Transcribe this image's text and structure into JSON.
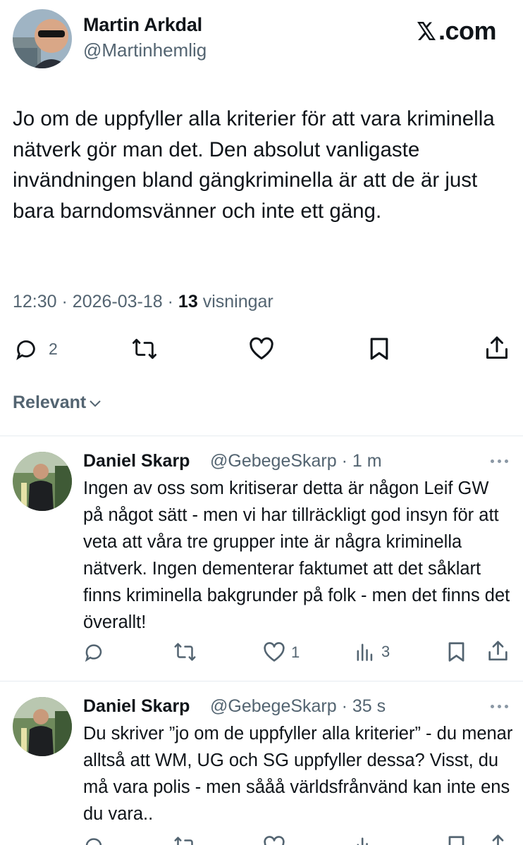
{
  "brand": {
    "name": "X",
    "domain_label": ".com"
  },
  "tweet": {
    "author_name": "Martin Arkdal",
    "author_handle": "@Martinhemlig",
    "text": "Jo om de uppfyller alla kriterier för att vara kriminella nätverk gör man det. Den absolut vanligaste invändningen bland gängkriminella är att de är just bara barndomsvänner och inte ett gäng.",
    "time": "12:30",
    "date": "2026-03-18",
    "separator": "·",
    "views": "13",
    "views_label": "visningar",
    "reply_count": "2",
    "icons": [
      "reply-icon",
      "retweet-icon",
      "like-icon",
      "bookmark-icon",
      "share-icon"
    ]
  },
  "sort": {
    "label": "Relevant",
    "icon": "chevron-down-icon"
  },
  "replies": [
    {
      "name": "Daniel Skarp",
      "handle": "@GebegeSkarp",
      "time": "· 1 m",
      "text": "Ingen av oss som kritiserar detta är någon Leif GW på något sätt - men vi har tillräckligt god insyn för att veta att våra tre grupper inte är några kriminella nätverk. Ingen dementerar faktumet att det såklart finns kriminella bakgrunder på folk - men det finns det överallt!",
      "likes": "1",
      "views": "3"
    },
    {
      "name": "Daniel Skarp",
      "handle": "@GebegeSkarp",
      "time": "· 35 s",
      "text": "Du skriver  ”jo om de uppfyller alla kriterier” - du menar alltså att WM, UG och SG uppfyller dessa? Visst, du må vara polis - men sååå världsfrånvänd kan inte ens du vara..",
      "likes": "",
      "views": ""
    }
  ],
  "colors": {
    "text": "#0f1419",
    "secondary": "#536471",
    "divider": "#e6ecf0"
  }
}
